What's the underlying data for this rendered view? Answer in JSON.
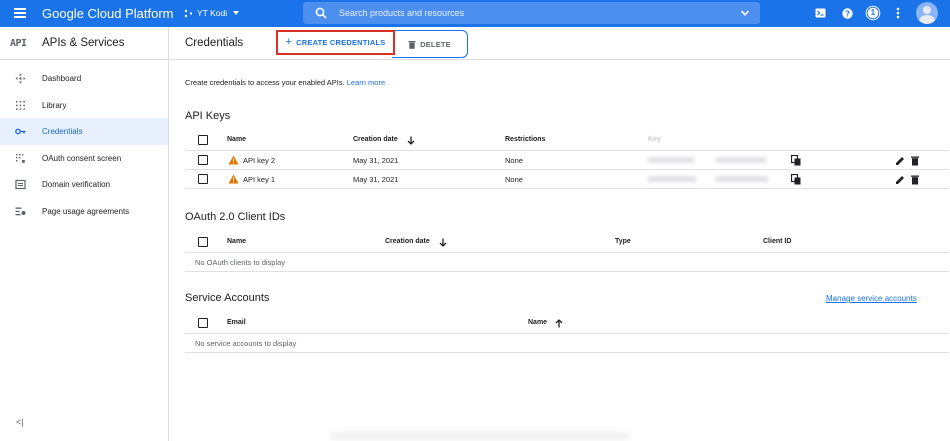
{
  "topbar": {
    "brand": "Google Cloud Platform",
    "project": "YT Kodi",
    "search_placeholder": "Search products and resources",
    "notification_count": "1"
  },
  "sidebar": {
    "logo": "API",
    "title": "APIs & Services",
    "items": [
      {
        "label": "Dashboard",
        "icon": "dashboard-icon"
      },
      {
        "label": "Library",
        "icon": "library-icon"
      },
      {
        "label": "Credentials",
        "icon": "key-icon",
        "active": true
      },
      {
        "label": "OAuth consent screen",
        "icon": "consent-icon"
      },
      {
        "label": "Domain verification",
        "icon": "domain-icon"
      },
      {
        "label": "Page usage agreements",
        "icon": "settings-list-icon"
      }
    ],
    "collapse_label": "<|"
  },
  "actionbar": {
    "title": "Credentials",
    "create_label": "CREATE CREDENTIALS",
    "delete_label": "DELETE"
  },
  "intro": {
    "text": "Create credentials to access your enabled APIs.",
    "link": "Learn more"
  },
  "api_keys": {
    "title": "API Keys",
    "headers": {
      "name": "Name",
      "creation_date": "Creation date",
      "restrictions": "Restrictions",
      "key": "Key"
    },
    "rows": [
      {
        "name": "API key 2",
        "date": "May 31, 2021",
        "restrictions": "None"
      },
      {
        "name": "API key 1",
        "date": "May 31, 2021",
        "restrictions": "None"
      }
    ]
  },
  "oauth": {
    "title": "OAuth 2.0 Client IDs",
    "headers": {
      "name": "Name",
      "creation_date": "Creation date",
      "type": "Type",
      "client_id": "Client ID"
    },
    "empty": "No OAuth clients to display"
  },
  "service_accounts": {
    "title": "Service Accounts",
    "manage_link": "Manage service accounts",
    "headers": {
      "email": "Email",
      "name": "Name"
    },
    "empty": "No service accounts to display"
  },
  "colors": {
    "primary": "#1a73e8",
    "highlight_border": "#d93025",
    "warning": "#e37400",
    "active_bg": "#e8f0fe"
  }
}
